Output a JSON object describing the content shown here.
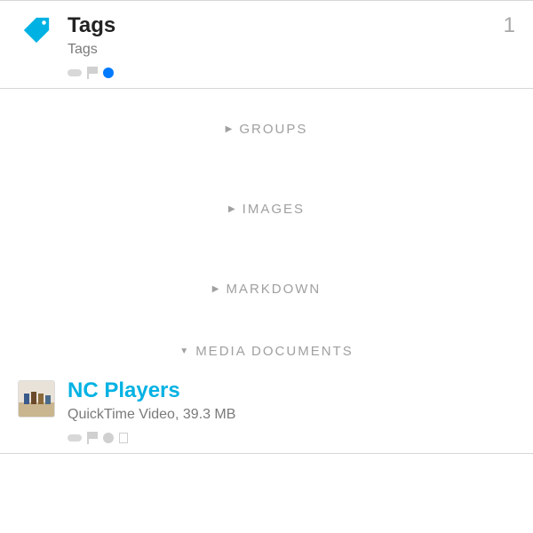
{
  "rows": {
    "tags": {
      "title": "Tags",
      "subtitle": "Tags",
      "count": "1"
    },
    "media": {
      "title": "NC Players",
      "subtitle": "QuickTime Video, 39.3 MB"
    }
  },
  "sections": {
    "groups": "GROUPS",
    "images": "IMAGES",
    "markdown": "MARKDOWN",
    "media_documents": "MEDIA DOCUMENTS"
  },
  "colors": {
    "accent": "#00b2e3",
    "blue_dot": "#007aff"
  }
}
